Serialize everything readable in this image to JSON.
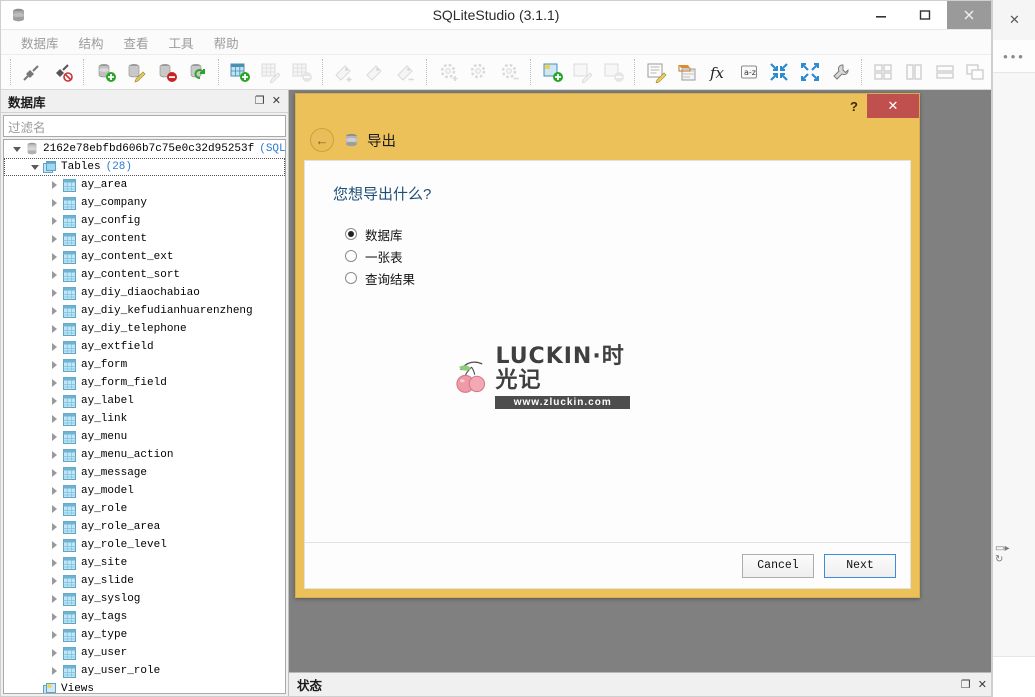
{
  "window": {
    "title": "SQLiteStudio (3.1.1)",
    "app_icon": "database-icon",
    "buttons": {
      "minimize": "minimize-icon",
      "maximize": "maximize-icon",
      "close": "close-icon"
    }
  },
  "menubar": {
    "items": [
      {
        "label": "数据库"
      },
      {
        "label": "结构"
      },
      {
        "label": "查看"
      },
      {
        "label": "工具"
      },
      {
        "label": "帮助"
      }
    ]
  },
  "toolbar": {
    "groups": [
      {
        "buttons": [
          {
            "name": "connect-db-icon",
            "enabled": true
          },
          {
            "name": "disconnect-db-icon",
            "enabled": true
          }
        ]
      },
      {
        "buttons": [
          {
            "name": "add-database-icon",
            "enabled": true
          },
          {
            "name": "edit-database-icon",
            "enabled": true
          },
          {
            "name": "remove-database-icon",
            "enabled": true
          },
          {
            "name": "refresh-database-icon",
            "enabled": true
          }
        ]
      },
      {
        "buttons": [
          {
            "name": "create-table-icon",
            "enabled": true
          },
          {
            "name": "edit-table-icon",
            "enabled": false
          },
          {
            "name": "delete-table-icon",
            "enabled": false
          },
          {
            "name": "create-index-icon",
            "enabled": false
          },
          {
            "name": "edit-index-icon",
            "enabled": false
          },
          {
            "name": "delete-index-icon",
            "enabled": false
          },
          {
            "name": "create-trigger-icon",
            "enabled": false
          },
          {
            "name": "edit-trigger-icon",
            "enabled": false
          },
          {
            "name": "delete-trigger-icon",
            "enabled": false
          },
          {
            "name": "create-view-icon",
            "enabled": true
          },
          {
            "name": "edit-view-icon",
            "enabled": false
          },
          {
            "name": "delete-view-icon",
            "enabled": false
          }
        ]
      },
      {
        "buttons": [
          {
            "name": "sql-editor-icon",
            "enabled": true
          },
          {
            "name": "import-export-icon",
            "enabled": true
          },
          {
            "name": "custom-function-icon",
            "enabled": true
          },
          {
            "name": "collation-icon",
            "enabled": true
          },
          {
            "name": "collapse-all-icon",
            "enabled": true
          },
          {
            "name": "expand-all-icon",
            "enabled": true
          },
          {
            "name": "configuration-icon",
            "enabled": true
          }
        ]
      },
      {
        "buttons": [
          {
            "name": "tile-windows-icon",
            "enabled": false
          },
          {
            "name": "tile-vertical-icon",
            "enabled": false
          },
          {
            "name": "tile-horizontal-icon",
            "enabled": false
          },
          {
            "name": "cascade-windows-icon",
            "enabled": false
          }
        ]
      }
    ]
  },
  "database_panel": {
    "title": "数据库",
    "dock_buttons": {
      "float": "float-icon",
      "close": "close-icon"
    },
    "filter": {
      "placeholder": "过滤名",
      "value": ""
    },
    "tree": {
      "root": {
        "label": "2162e78ebfbd606b7c75e0c32d95253f",
        "suffix": "(SQLite",
        "expanded": true
      },
      "tables_node": {
        "label": "Tables",
        "count": "(28)",
        "expanded": true,
        "selected": true
      },
      "tables": [
        "ay_area",
        "ay_company",
        "ay_config",
        "ay_content",
        "ay_content_ext",
        "ay_content_sort",
        "ay_diy_diaochabiao",
        "ay_diy_kefudianhuarenzheng",
        "ay_diy_telephone",
        "ay_extfield",
        "ay_form",
        "ay_form_field",
        "ay_label",
        "ay_link",
        "ay_menu",
        "ay_menu_action",
        "ay_message",
        "ay_model",
        "ay_role",
        "ay_role_area",
        "ay_role_level",
        "ay_site",
        "ay_slide",
        "ay_syslog",
        "ay_tags",
        "ay_type",
        "ay_user",
        "ay_user_role"
      ],
      "views_node": {
        "label": "Views"
      }
    }
  },
  "status_panel": {
    "title": "状态",
    "dock_buttons": {
      "float": "float-icon",
      "close": "close-icon"
    }
  },
  "export_dialog": {
    "title": "导出",
    "title_icon": "export-database-icon",
    "back_icon": "back-arrow-icon",
    "help_label": "?",
    "close_label": "✕",
    "question": "您想导出什么?",
    "options": [
      {
        "label": "数据库",
        "checked": true
      },
      {
        "label": "一张表",
        "checked": false
      },
      {
        "label": "查询结果",
        "checked": false
      }
    ],
    "buttons": {
      "cancel": "Cancel",
      "next": "Next"
    },
    "watermark": {
      "brand": "LUCKIN·时光记",
      "url": "www.zluckin.com"
    }
  },
  "background_window": {
    "close_icon": "close-icon",
    "more_icon": "more-dots-icon"
  },
  "colors": {
    "dialog_header": "#edc15a",
    "dialog_close": "#c0504d",
    "question_text": "#1f4e79",
    "tree_accent": "#2b7bd4",
    "workspace": "#808080"
  }
}
